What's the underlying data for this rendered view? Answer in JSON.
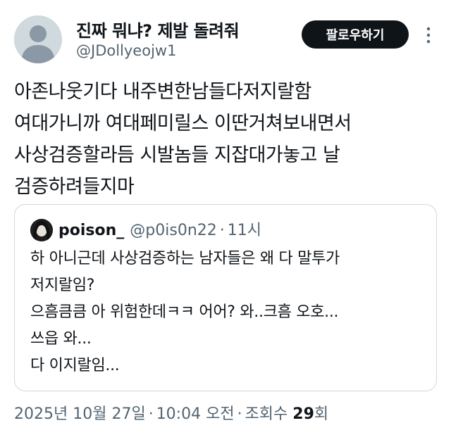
{
  "author": {
    "display_name": "진짜 뭐냐? 제발 돌려줘",
    "handle": "@JDollyeojw1"
  },
  "follow_button_label": "팔로우하기",
  "more_icon": "more-vertical-icon",
  "tweet_text": "아존나웃기다 내주변한남들다저지랄함\n여대가니까 여대페미릴스 이딴거쳐보내면서\n사상검증할라듬 시발놈들 지잡대가놓고 날\n검증하려들지마",
  "quoted_tweet": {
    "display_name": "poison_",
    "handle": "@p0is0n22",
    "separator": "·",
    "time": "11시",
    "text": "하 아니근데 사상검증하는 남자들은 왜 다 말투가\n저지랄임?\n으흠큼큼 아 위험한데ㅋㅋ 어어? 와..크흠 오호...\n쓰읍 와...\n다 이지랄임..."
  },
  "meta": {
    "date": "2025년 10월 27일",
    "separator": "·",
    "time": "10:04 오전",
    "views_label": "조회수",
    "views_count": "29",
    "views_suffix": "회"
  },
  "colors": {
    "text_primary": "#0f1419",
    "text_secondary": "#536471",
    "border": "#cfd9de",
    "follow_bg": "#0f1419",
    "follow_text": "#ffffff"
  }
}
